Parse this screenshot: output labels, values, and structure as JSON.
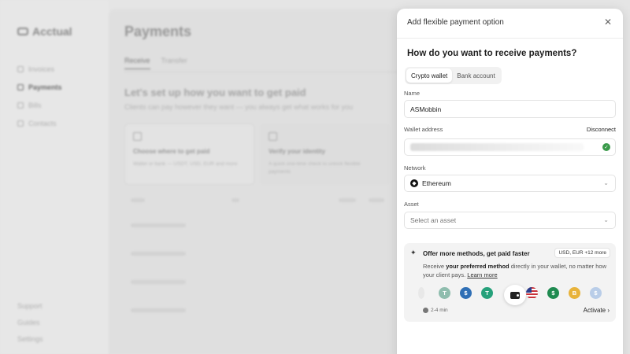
{
  "background": {
    "brand": "Acctual",
    "nav": [
      {
        "label": "Invoices",
        "active": false
      },
      {
        "label": "Payments",
        "active": true
      },
      {
        "label": "Bills",
        "active": false
      },
      {
        "label": "Contacts",
        "active": false
      }
    ],
    "nav_bottom": [
      "Support",
      "Guides",
      "Settings"
    ],
    "page_title": "Payments",
    "tabs": [
      "Receive",
      "Transfer"
    ],
    "heading": "Let's set up how you want to get paid",
    "subheading": "Clients can pay however they want — you always get what works for you",
    "cards": [
      {
        "title": "Choose where to get paid",
        "desc": "Wallet or bank — USDT, USD, EUR and more"
      },
      {
        "title": "Verify your identity",
        "desc": "A quick one-time check to unlock flexible payments"
      }
    ]
  },
  "modal": {
    "title": "Add flexible payment option",
    "question": "How do you want to receive payments?",
    "options": [
      {
        "label": "Crypto wallet",
        "active": true
      },
      {
        "label": "Bank account",
        "active": false
      }
    ],
    "name_label": "Name",
    "name_value": "ASMobbin",
    "wallet_label": "Wallet address",
    "disconnect_label": "Disconnect",
    "network_label": "Network",
    "network_value": "Ethereum",
    "asset_label": "Asset",
    "asset_placeholder": "Select an asset",
    "promo": {
      "title": "Offer more methods, get paid faster",
      "badge": "USD, EUR +12 more",
      "desc_prefix": "Receive ",
      "desc_bold": "your preferred method",
      "desc_suffix": " directly in your wallet, no matter how your client pays. ",
      "learn_more": "Learn more",
      "time": "2-4 min",
      "activate": "Activate"
    },
    "coins": [
      {
        "icon": "usdt-icon",
        "glyph": "T",
        "color": "#8fbdae"
      },
      {
        "icon": "usdc-icon",
        "glyph": "$",
        "color": "#2f6fb5"
      },
      {
        "icon": "tether-icon",
        "glyph": "T",
        "color": "#26a17b"
      },
      {
        "icon": "usd-flag-icon",
        "glyph": "",
        "color": "#ffffff"
      },
      {
        "icon": "pyusd-icon",
        "glyph": "$",
        "color": "#1f8a50"
      },
      {
        "icon": "dai-icon",
        "glyph": "B",
        "color": "#e8b33a"
      },
      {
        "icon": "usdc-light-icon",
        "glyph": "$",
        "color": "#b9cde8"
      }
    ]
  }
}
